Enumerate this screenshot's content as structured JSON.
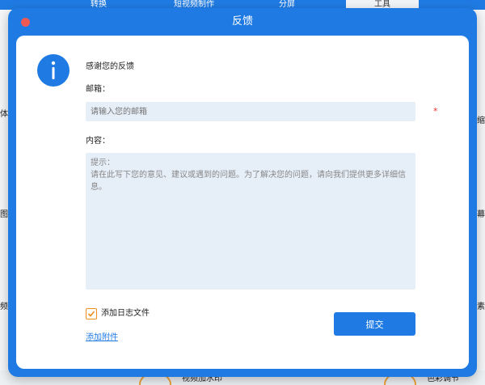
{
  "background": {
    "tabs": [
      "转换",
      "短视频制作",
      "分屏",
      "工具"
    ],
    "left_labels": [
      "体",
      "图片",
      "频"
    ],
    "right_labels": [
      "缩",
      "字幕",
      "素"
    ],
    "tools": [
      "视频加水印",
      "色彩调节"
    ]
  },
  "dialog": {
    "title": "反馈",
    "thanks": "感谢您的反馈",
    "email_label": "邮箱：",
    "email_placeholder": "请输入您的邮箱",
    "required_mark": "*",
    "content_label": "内容：",
    "content_hint_title": "提示：",
    "content_hint_body": "请在此写下您的意见、建议或遇到的问题。为了解决您的问题，请向我们提供更多详细信息。",
    "log_checkbox_label": "添加日志文件",
    "log_checked": true,
    "attach_link": "添加附件",
    "submit_label": "提交"
  },
  "colors": {
    "accent": "#1f7be3",
    "close": "#ee5a52",
    "checkbox": "#f08c1e",
    "required": "#e33333"
  }
}
